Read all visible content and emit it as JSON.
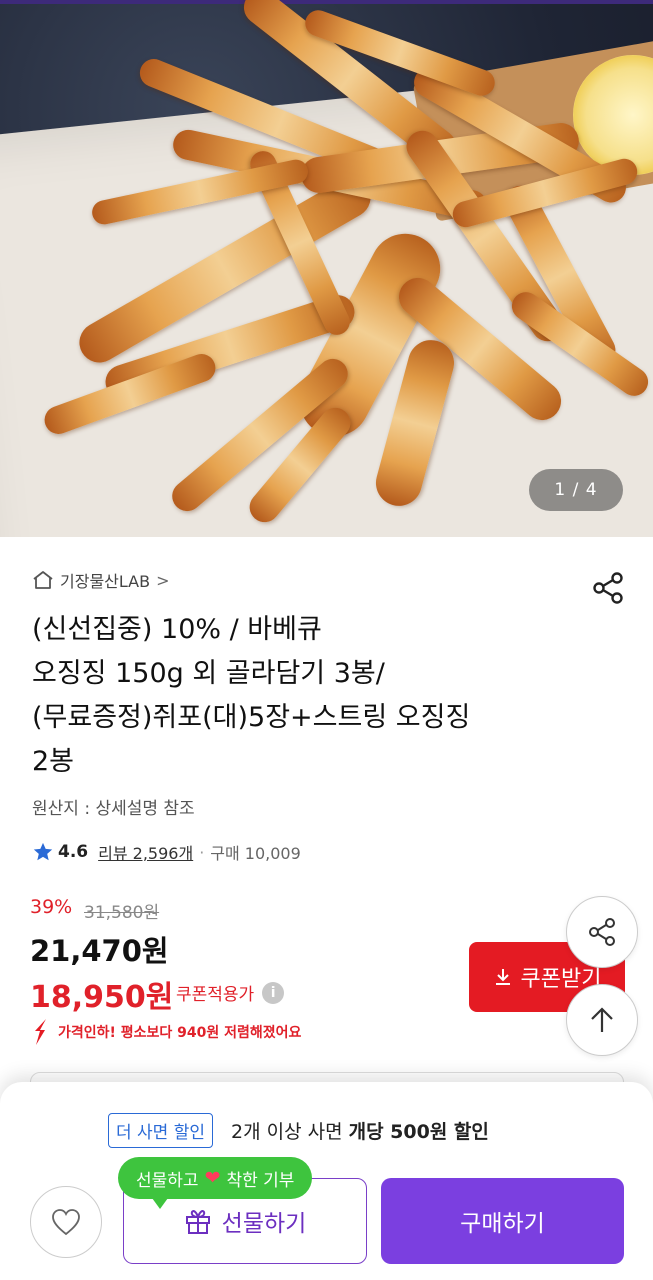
{
  "image_counter": "1 / 4",
  "store": {
    "name": "기장물산LAB",
    "chevron": ">"
  },
  "product": {
    "title_lines": [
      "(신선집중) 10% / 바베큐",
      "오징징 150g 외 골라담기 3봉/",
      "(무료증정)쥐포(대)5장+스트링 오징징",
      "2봉"
    ],
    "origin": "원산지 : 상세설명 참조"
  },
  "rating": {
    "score": "4.6",
    "reviews": "리뷰 2,596개",
    "separator": "·",
    "purchases": "구매 10,009"
  },
  "price": {
    "discount": "39%",
    "original": "31,580원",
    "current": "21,470원",
    "coupon_price": "18,950원",
    "coupon_note": "쿠폰적용가",
    "info_symbol": "i",
    "drop_message": "가격인하! 평소보다 940원 저렴해졌어요"
  },
  "buttons": {
    "coupon": "쿠폰받기",
    "gift": "선물하기",
    "buy": "구매하기"
  },
  "bulk": {
    "tag": "더 사면 할인",
    "text": "2개 이상 사면",
    "strong": "개당 500원 할인"
  },
  "bubble": {
    "before": "선물하고",
    "heart": "❤",
    "after": "착한 기부"
  },
  "icons": [
    "home-icon",
    "share-icon",
    "star-icon",
    "info-icon",
    "down-arrow-icon",
    "download-icon",
    "up-arrow-icon",
    "heart-icon",
    "gift-icon"
  ],
  "colors": {
    "accent_red": "#e41b23",
    "purple": "#7b3fe0",
    "green": "#3ec43e",
    "blue_tag": "#2a6ad6"
  }
}
